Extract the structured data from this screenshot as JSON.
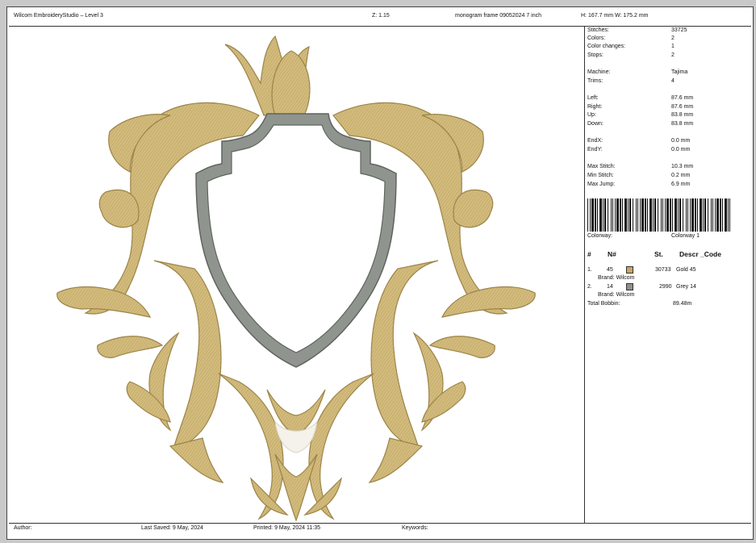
{
  "header": {
    "title": "Wilcom EmbroideryStudio – Level 3",
    "zoom": "Z: 1.15",
    "filename": "monogram frame 09052024 7 inch",
    "size": "H: 167.7 mm   W: 175.2 mm"
  },
  "stats": [
    {
      "key": "Stitches:",
      "value": "33725"
    },
    {
      "key": "Colors:",
      "value": "2"
    },
    {
      "key": "Color changes:",
      "value": "1"
    },
    {
      "key": "Stops:",
      "value": "2"
    },
    {
      "key": "Machine:",
      "value": "Tajima"
    },
    {
      "key": "Trims:",
      "value": "4"
    },
    {
      "key": "Left:",
      "value": "87.6 mm"
    },
    {
      "key": "Right:",
      "value": "87.6 mm"
    },
    {
      "key": "Up:",
      "value": "83.8 mm"
    },
    {
      "key": "Down:",
      "value": "83.8 mm"
    },
    {
      "key": "EndX:",
      "value": "0.0 mm"
    },
    {
      "key": "EndY:",
      "value": "0.0 mm"
    },
    {
      "key": "Max Stitch:",
      "value": "10.3 mm"
    },
    {
      "key": "Min Stitch:",
      "value": "0.2 mm"
    },
    {
      "key": "Max Jump:",
      "value": "6.9 mm"
    }
  ],
  "colorway": {
    "label": "Colorway:",
    "value": "Colorway 1"
  },
  "thread_table": {
    "headers": [
      "#",
      "N#",
      "St.",
      "Descr _Code"
    ],
    "rows": [
      {
        "index": "1.",
        "n": "45",
        "color": "#c8a569",
        "stitches": "30733",
        "descr": "Gold 45",
        "brand": "Brand: Wilcom"
      },
      {
        "index": "2.",
        "n": "14",
        "color": "#8d918a",
        "stitches": "2990",
        "descr": "Grey 14",
        "brand": "Brand: Wilcom"
      }
    ],
    "bobbin_label": "Total Bobbin:",
    "bobbin_value": "89.48m"
  },
  "footer": {
    "author": "Author:",
    "last_saved": "Last Saved:  9 May, 2024",
    "printed": "Printed:  9 May, 2024 11:35",
    "keywords": "Keywords:"
  },
  "colors": {
    "gold": "#d2bb7c",
    "gold_dark": "#9c8448",
    "grey": "#8f958e",
    "grey_dark": "#5e645e"
  }
}
